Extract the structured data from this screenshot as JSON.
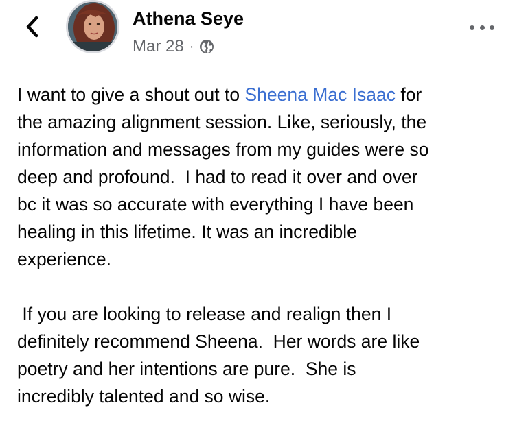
{
  "header": {
    "back_icon": "chevron-left-icon",
    "author_name": "Athena Seye",
    "date": "Mar 28",
    "separator": "·",
    "privacy_icon": "globe-icon",
    "more_icon": "more-horizontal-icon"
  },
  "post": {
    "p1": {
      "line1_before": "I want to give a shout out to ",
      "mention": "Sheena Mac Isaac",
      "line1_after": " for",
      "line2": "the amazing alignment session. Like, seriously, the",
      "line3": "information and messages from my guides were so",
      "line4": "deep and profound.  I had to read it over and over",
      "line5": "bc it was so accurate with everything I have been",
      "line6": "healing in this lifetime. It was an incredible",
      "line7": "experience."
    },
    "p2": {
      "line1": " If you are looking to release and realign then I",
      "line2": "definitely recommend Sheena.  Her words are like",
      "line3": "poetry and her intentions are pure.  She is",
      "line4": "incredibly talented and so wise."
    }
  },
  "colors": {
    "mention": "#3b6fd1",
    "meta_text": "#65676b",
    "body_text": "#050505"
  }
}
